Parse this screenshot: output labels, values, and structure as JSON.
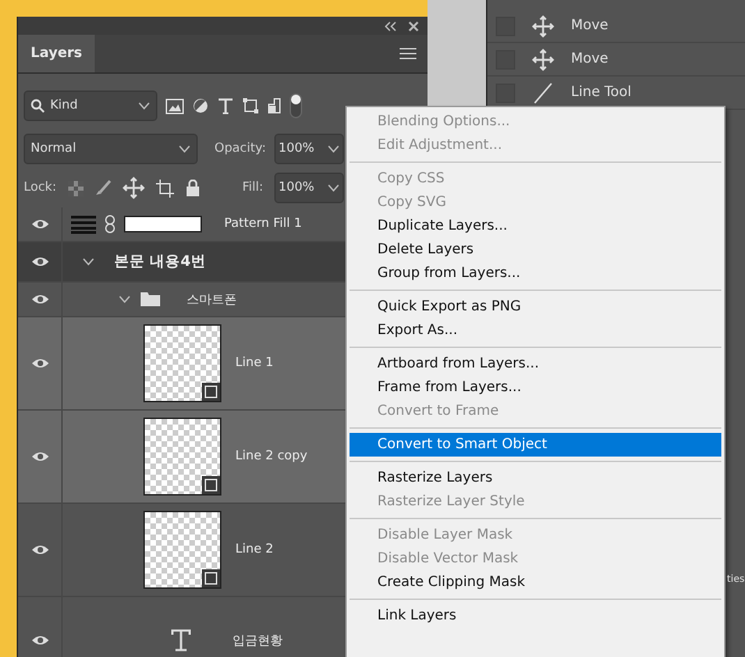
{
  "layers_panel": {
    "tab": {
      "label": "Layers",
      "selected": true
    },
    "filter": {
      "value": "Kind"
    },
    "blend_mode": {
      "value": "Normal"
    },
    "opacity": {
      "label": "Opacity:",
      "value": "100%"
    },
    "lock": {
      "label": "Lock:"
    },
    "fill": {
      "label": "Fill:",
      "value": "100%"
    },
    "layers": [
      {
        "kind": "pattern",
        "name": "Pattern Fill 1",
        "visible": true,
        "selected": false
      },
      {
        "kind": "group",
        "name": "본문 내용4번",
        "visible": true,
        "selected": false,
        "expanded": true,
        "children": [
          {
            "kind": "group",
            "name": "스마트폰",
            "visible": true,
            "selected": false,
            "expanded": true,
            "children": [
              {
                "kind": "shape",
                "name": "Line 1",
                "visible": true,
                "selected": true
              },
              {
                "kind": "shape",
                "name": "Line 2 copy",
                "visible": true,
                "selected": true
              },
              {
                "kind": "shape",
                "name": "Line 2",
                "visible": true,
                "selected": false
              },
              {
                "kind": "text",
                "name": "입금현황",
                "visible": true,
                "selected": false
              }
            ]
          }
        ]
      }
    ]
  },
  "history_panel": {
    "items": [
      {
        "kind": "move",
        "label": "Move",
        "checked": false
      },
      {
        "kind": "move",
        "label": "Move",
        "checked": false
      },
      {
        "kind": "line",
        "label": "Line Tool",
        "checked": false
      }
    ],
    "partial_label": "ties"
  },
  "context_menu": {
    "sections": [
      [
        {
          "label": "Blending Options...",
          "disabled": true,
          "selected": false
        },
        {
          "label": "Edit Adjustment...",
          "disabled": true,
          "selected": false
        }
      ],
      [
        {
          "label": "Copy CSS",
          "disabled": true,
          "selected": false
        },
        {
          "label": "Copy SVG",
          "disabled": true,
          "selected": false
        },
        {
          "label": "Duplicate Layers...",
          "disabled": false,
          "selected": false
        },
        {
          "label": "Delete Layers",
          "disabled": false,
          "selected": false
        },
        {
          "label": "Group from Layers...",
          "disabled": false,
          "selected": false
        }
      ],
      [
        {
          "label": "Quick Export as PNG",
          "disabled": false,
          "selected": false
        },
        {
          "label": "Export As...",
          "disabled": false,
          "selected": false
        }
      ],
      [
        {
          "label": "Artboard from Layers...",
          "disabled": false,
          "selected": false
        },
        {
          "label": "Frame from Layers...",
          "disabled": false,
          "selected": false
        },
        {
          "label": "Convert to Frame",
          "disabled": true,
          "selected": false
        }
      ],
      [
        {
          "label": "Convert to Smart Object",
          "disabled": false,
          "selected": true
        }
      ],
      [
        {
          "label": "Rasterize Layers",
          "disabled": false,
          "selected": false
        },
        {
          "label": "Rasterize Layer Style",
          "disabled": true,
          "selected": false
        }
      ],
      [
        {
          "label": "Disable Layer Mask",
          "disabled": true,
          "selected": false
        },
        {
          "label": "Disable Vector Mask",
          "disabled": true,
          "selected": false
        },
        {
          "label": "Create Clipping Mask",
          "disabled": false,
          "selected": false
        }
      ],
      [
        {
          "label": "Link Layers",
          "disabled": false,
          "selected": false
        }
      ]
    ]
  }
}
